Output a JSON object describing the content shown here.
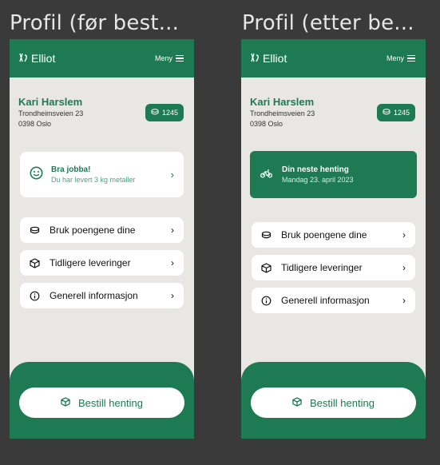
{
  "frames": [
    {
      "title": "Profil (før best...",
      "brand": "Elliot",
      "menu_label": "Meny",
      "user": {
        "name": "Kari Harslem",
        "street": "Trondheimsveien 23",
        "postal": "0398 Oslo",
        "points": "1245"
      },
      "card": {
        "title": "Bra jobba!",
        "subtitle": "Du har levert 3 kg metaller"
      },
      "menu_items": [
        {
          "label": "Bruk poengene dine",
          "icon": "coins-icon"
        },
        {
          "label": "Tidligere leveringer",
          "icon": "box-icon"
        },
        {
          "label": "Generell informasjon",
          "icon": "info-icon"
        }
      ],
      "cta": "Bestill henting"
    },
    {
      "title": "Profil (etter be...",
      "brand": "Elliot",
      "menu_label": "Meny",
      "user": {
        "name": "Kari Harslem",
        "street": "Trondheimsveien 23",
        "postal": "0398 Oslo",
        "points": "1245"
      },
      "card": {
        "title": "Din neste henting",
        "subtitle": "Mandag 23. april 2023"
      },
      "menu_items": [
        {
          "label": "Bruk poengene dine",
          "icon": "coins-icon"
        },
        {
          "label": "Tidligere leveringer",
          "icon": "box-icon"
        },
        {
          "label": "Generell informasjon",
          "icon": "info-icon"
        }
      ],
      "cta": "Bestill henting"
    }
  ],
  "colors": {
    "brand_green": "#1e7a52",
    "background": "#3a3a3a",
    "screen": "#e9e7e3"
  }
}
